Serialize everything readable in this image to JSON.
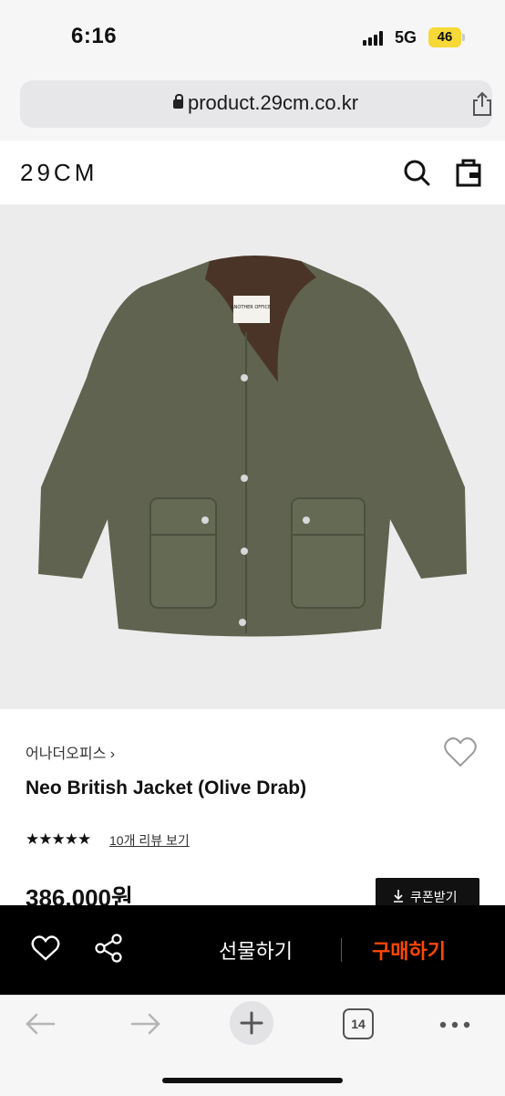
{
  "status_bar": {
    "time": "6:16",
    "network": "5G",
    "battery": "46"
  },
  "browser": {
    "url": "product.29cm.co.kr",
    "tab_count": "14"
  },
  "site": {
    "logo": "29CM"
  },
  "product": {
    "brand": "어나더오피스",
    "name": "Neo British Jacket (Olive Drab)",
    "rating_stars": "★★★★★",
    "review_link": "10개 리뷰 보기",
    "price": "386,000원",
    "coupon_label": "쿠폰받기",
    "image_label_text": "ANOTHER OFFICE.",
    "image_colors": {
      "jacket": "#5f634f",
      "collar": "#4a3428",
      "background": "#ececec"
    }
  },
  "action_bar": {
    "gift_label": "선물하기",
    "buy_label": "구매하기",
    "buy_color": "#ff4800"
  },
  "icons": [
    "lock-icon",
    "share-icon",
    "search-icon",
    "bag-icon",
    "heart-icon",
    "share-nodes-icon",
    "download-icon",
    "back-arrow-icon",
    "forward-arrow-icon",
    "plus-icon",
    "more-icon"
  ]
}
